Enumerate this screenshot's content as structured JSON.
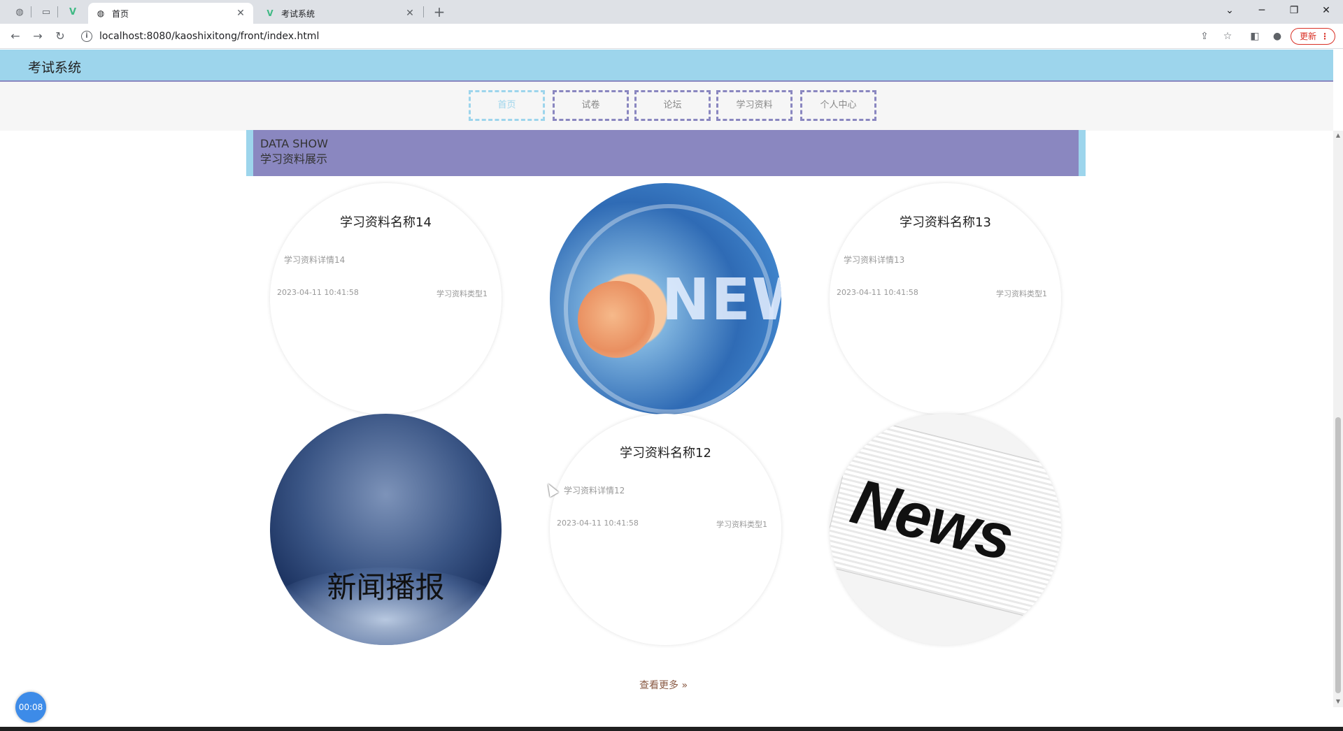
{
  "browser": {
    "tabs": [
      {
        "title": "首页",
        "active": true
      },
      {
        "title": "考试系统",
        "active": false
      }
    ],
    "url": "localhost:8080/kaoshixitong/front/index.html",
    "update_label": "更新"
  },
  "site": {
    "title": "考试系统",
    "nav": [
      "首页",
      "试卷",
      "论坛",
      "学习资料",
      "个人中心"
    ],
    "active_nav": "首页"
  },
  "section": {
    "en": "DATA SHOW",
    "zh": "学习资料展示"
  },
  "cards": [
    {
      "title": "学习资料名称14",
      "detail": "学习资料详情14",
      "date": "2023-04-11 10:41:58",
      "type": "学习资料类型1"
    },
    {
      "title": "学习资料名称13",
      "detail": "学习资料详情13",
      "date": "2023-04-11 10:41:58",
      "type": "学习资料类型1"
    },
    {
      "title": "学习资料名称12",
      "detail": "学习资料详情12",
      "date": "2023-04-11 10:41:58",
      "type": "学习资料类型1"
    }
  ],
  "images": {
    "globe_word": "NEW",
    "broadcast_text": "新闻播报",
    "news_word": "News"
  },
  "more_label": "查看更多 »",
  "timer": "00:08",
  "colors": {
    "header_bg": "#9dd5ec",
    "accent_purple": "#8a87c0",
    "more_link": "#8a5a44",
    "timer_bg": "#3d8be8"
  }
}
